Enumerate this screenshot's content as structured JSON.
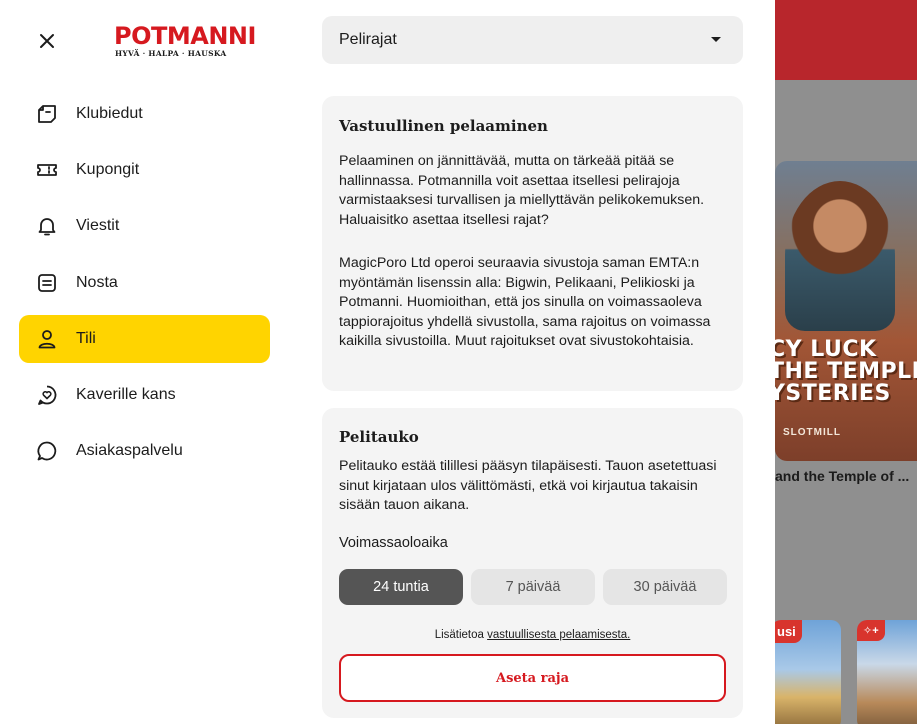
{
  "background": {
    "game_title": "CY LUCK\nTHE TEMPLE\nYSTERIES",
    "studio": "SLOTMILL",
    "card_label": "and the Temple of ...",
    "badge1": "usi",
    "badge2": "✧+"
  },
  "brand": {
    "name": "POTMANNI",
    "tagline": "HYVÄ · HALPA · HAUSKA",
    "accent_color": "#d6191f",
    "active_color": "#ffd400"
  },
  "nav": {
    "items": [
      {
        "label": "Klubiedut",
        "icon": "ticket-icon"
      },
      {
        "label": "Kupongit",
        "icon": "coupon-icon"
      },
      {
        "label": "Viestit",
        "icon": "bell-icon"
      },
      {
        "label": "Nosta",
        "icon": "withdraw-icon"
      },
      {
        "label": "Tili",
        "icon": "user-icon",
        "active": true
      },
      {
        "label": "Kaverille kans",
        "icon": "heart-chat-icon"
      },
      {
        "label": "Asiakaspalvelu",
        "icon": "chat-bubble-icon"
      }
    ]
  },
  "select": {
    "value": "Pelirajat"
  },
  "responsible": {
    "title": "Vastuullinen pelaaminen",
    "para1": "Pelaaminen on jännittävää, mutta on tärkeää pitää se hallinnassa. Potmannilla voit asettaa itsellesi pelirajoja varmistaaksesi turvallisen ja miellyttävän pelikokemuksen. Haluaisitko asettaa itsellesi rajat?",
    "para2": "MagicPoro Ltd operoi seuraavia sivustoja saman EMTA:n myöntämän lisenssin alla: Bigwin, Pelikaani, Pelikioski ja Potmanni. Huomioithan, että jos sinulla on voimassaoleva tappiorajoitus yhdellä sivustolla, sama rajoitus on voimassa kaikilla sivustoilla. Muut rajoitukset ovat sivustokohtaisia."
  },
  "pause": {
    "title": "Pelitauko",
    "description": "Pelitauko estää tilillesi pääsyn tilapäisesti. Tauon asetettuasi sinut kirjataan ulos välittömästi, etkä voi kirjautua takaisin sisään tauon aikana.",
    "duration_label": "Voimassaoloaika",
    "options": [
      "24 tuntia",
      "7 päivää",
      "30 päivää"
    ],
    "selected": "24 tuntia",
    "info_prefix": "Lisätietoa ",
    "info_link": "vastuullisesta pelaamisesta.",
    "submit_label": "Aseta raja"
  }
}
